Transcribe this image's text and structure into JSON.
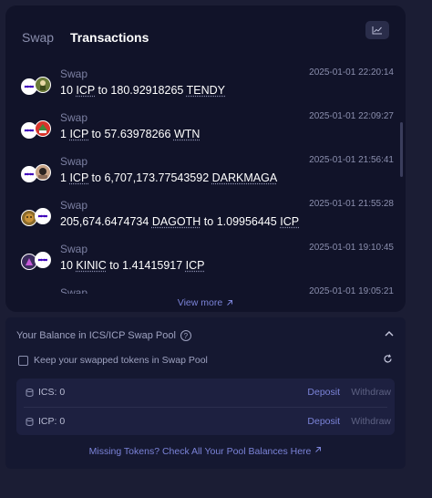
{
  "tabs": [
    {
      "label": "Swap",
      "active": false
    },
    {
      "label": "Transactions",
      "active": true
    }
  ],
  "chart_button_icon": "line-chart-icon",
  "transactions": [
    {
      "type": "Swap",
      "time": "2025-01-01 22:20:14",
      "amount_in": "10",
      "token_in": "ICP",
      "to": "to",
      "amount_out": "180.92918265",
      "token_out": "TENDY",
      "icons": [
        "icp-icon",
        "tendy-token-icon"
      ]
    },
    {
      "type": "Swap",
      "time": "2025-01-01 22:09:27",
      "amount_in": "1",
      "token_in": "ICP",
      "to": "to",
      "amount_out": "57.63978266",
      "token_out": "WTN",
      "icons": [
        "icp-icon",
        "wtn-token-icon"
      ]
    },
    {
      "type": "Swap",
      "time": "2025-01-01 21:56:41",
      "amount_in": "1",
      "token_in": "ICP",
      "to": "to",
      "amount_out": "6,707,173.77543592",
      "token_out": "DARKMAGA",
      "icons": [
        "icp-icon",
        "darkmaga-token-icon"
      ]
    },
    {
      "type": "Swap",
      "time": "2025-01-01 21:55:28",
      "amount_in": "205,674.6474734",
      "token_in": "DAGOTH",
      "to": "to",
      "amount_out": "1.09956445",
      "token_out": "ICP",
      "icons": [
        "dagoth-token-icon",
        "icp-icon"
      ]
    },
    {
      "type": "Swap",
      "time": "2025-01-01 19:10:45",
      "amount_in": "10",
      "token_in": "KINIC",
      "to": "to",
      "amount_out": "1.41415917",
      "token_out": "ICP",
      "icons": [
        "kinic-token-icon",
        "icp-icon"
      ]
    },
    {
      "type": "Swap",
      "time": "2025-01-01 19:05:21",
      "amount_in": "",
      "token_in": "",
      "to": "",
      "amount_out": "",
      "token_out": "",
      "icons": []
    }
  ],
  "view_more": "View more",
  "pool": {
    "title": "Your Balance in ICS/ICP Swap Pool",
    "keep_label": "Keep your swapped tokens in Swap Pool",
    "keep_checked": false,
    "balances": [
      {
        "label": "ICS: 0",
        "deposit": "Deposit",
        "withdraw": "Withdraw"
      },
      {
        "label": "ICP: 0",
        "deposit": "Deposit",
        "withdraw": "Withdraw"
      }
    ],
    "missing_link": "Missing Tokens? Check All Your Pool Balances Here"
  },
  "colors": {
    "background": "#1b1d34",
    "card": "#111329",
    "accent": "#7b83d8",
    "muted": "#8b8fae"
  }
}
